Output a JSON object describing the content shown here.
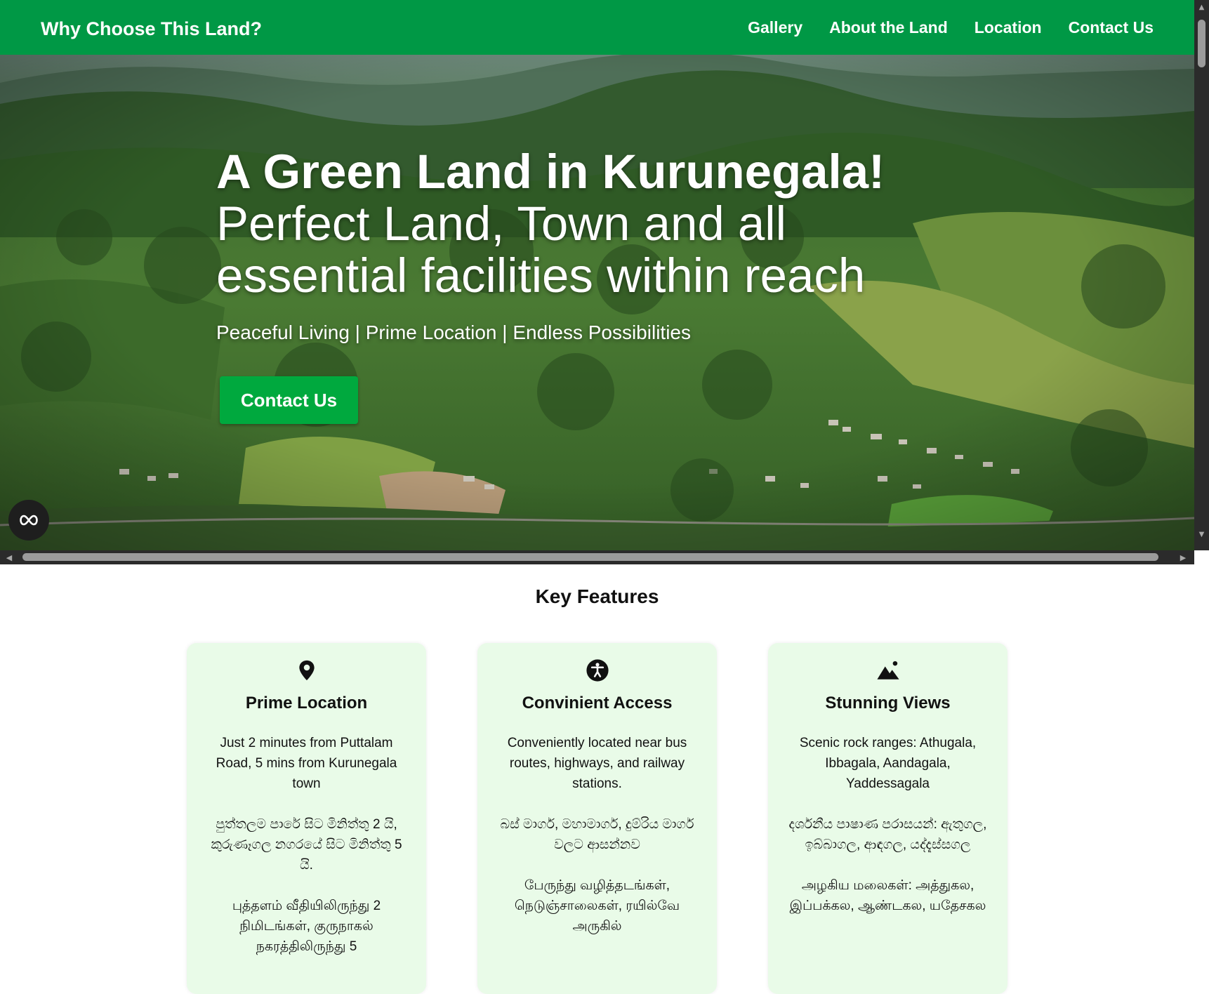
{
  "header": {
    "brand": "Why Choose This Land?",
    "nav": [
      "Gallery",
      "About the Land",
      "Location",
      "Contact Us"
    ]
  },
  "hero": {
    "title_line1": "A Green Land in Kurunegala!",
    "title_line2": "Perfect Land, Town and all",
    "title_line3": "essential facilities within reach",
    "tagline": "Peaceful Living | Prime Location | Endless Possibilities",
    "cta_label": "Contact Us",
    "float_icon": "infinity-icon"
  },
  "features": {
    "title": "Key Features",
    "cards": [
      {
        "icon": "map-pin-icon",
        "title": "Prime Location",
        "en": "Just 2 minutes from Puttalam Road, 5 mins from Kurunegala town",
        "si": "පුත්තලම පාරේ සිට මිනිත්තු 2 යි, කුරුණෑගල නගරයේ සිට මිනිත්තු 5 යි.",
        "ta": "புத்தளம் வீதியிலிருந்து 2 நிமிடங்கள், குருநாகல் நகரத்திலிருந்து 5"
      },
      {
        "icon": "accessibility-icon",
        "title": "Convinient Access",
        "en": "Conveniently located near bus routes, highways, and railway stations.",
        "si": "බස් මාර්ග, මහාමාර්ග, දුම්රිය මාර්ග වලට ආසන්නව",
        "ta": "பேருந்து வழித்தடங்கள், நெடுஞ்சாலைகள், ரயில்வே அருகில்"
      },
      {
        "icon": "mountain-icon",
        "title": "Stunning Views",
        "en": "Scenic rock ranges: Athugala, Ibbagala, Aandagala, Yaddessagala",
        "si": "දර්ශනීය පාෂාණ පරාසයන්: ඇතුගල, ඉබ්බාගල, ආඳගල, යද්දැස්සගල",
        "ta": "அழகிய மலைகள்: அத்துகல, இப்பக்கல, ஆண்டகல, யதேசகல"
      }
    ]
  },
  "colors": {
    "brand_green": "#009845",
    "button_green": "#00a93e",
    "card_bg": "#e9fbe8"
  }
}
